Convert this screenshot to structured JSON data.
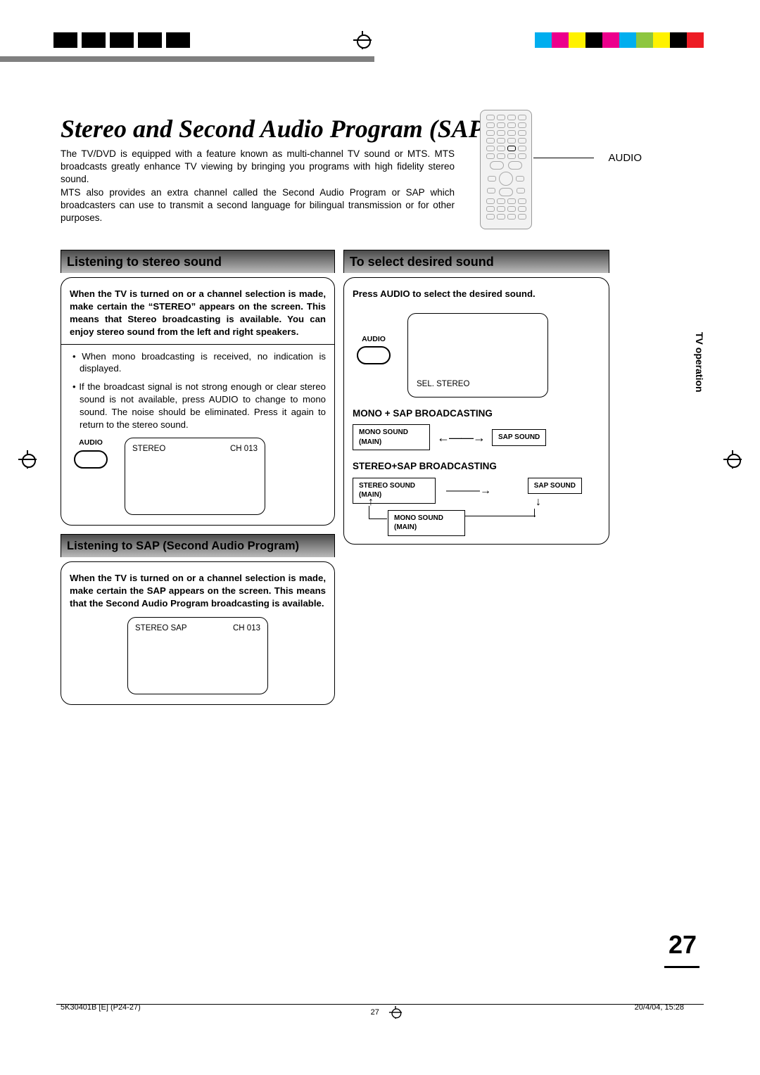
{
  "title": "Stereo and Second Audio Program (SAP)",
  "intro": "The TV/DVD is equipped with a feature known as multi-channel TV sound or MTS. MTS broadcasts greatly enhance TV viewing by bringing you programs with high fidelity stereo sound.\nMTS also provides an extra channel called the Second Audio Program or SAP which broadcasters can use to transmit a second language for bilingual transmission or for other purposes.",
  "remote_label": "AUDIO",
  "side_tab": "TV operation",
  "sections": {
    "stereo": {
      "heading": "Listening to stereo sound",
      "lead": "When the TV is turned on or a channel selection is made, make certain the “STEREO” appears on the screen. This means that Stereo broadcasting is available. You can enjoy stereo sound from the left and right speakers.",
      "bullet1": "• When mono broadcasting is received, no indication is displayed.",
      "bullet2": "• If the broadcast signal is not strong enough or clear stereo sound is not available, press AUDIO to change to mono sound. The noise should be eliminated. Press it again to return to the stereo sound.",
      "tv_left": "STEREO",
      "tv_right": "CH 013",
      "btn_label": "AUDIO"
    },
    "sap": {
      "heading": "Listening to SAP (Second Audio Program)",
      "lead": "When the TV is turned on or a channel selection is made, make certain the SAP appears on the screen. This means that the Second Audio Program broadcasting is available.",
      "tv_left": "STEREO  SAP",
      "tv_right": "CH 013"
    },
    "select": {
      "heading": "To select desired sound",
      "lead": "Press AUDIO to select the desired sound.",
      "btn_label": "AUDIO",
      "tv_text": "SEL. STEREO",
      "mono_sap_label": "MONO + SAP BROADCASTING",
      "stereo_sap_label": "STEREO+SAP BROADCASTING",
      "box_mono_main": "MONO SOUND (MAIN)",
      "box_sap": "SAP SOUND",
      "box_stereo_main": "STEREO SOUND (MAIN)",
      "box_mono_main2": "MONO SOUND (MAIN)"
    }
  },
  "page_number": "27",
  "footer": {
    "left": "5K30401B [E] (P24-27)",
    "center": "27",
    "right": "20/4/04, 15:28"
  },
  "reg_colors": [
    "#00aeef",
    "#ec008c",
    "#fff200",
    "#000000",
    "#ec008c",
    "#00aeef",
    "#fff200",
    "#000000"
  ]
}
